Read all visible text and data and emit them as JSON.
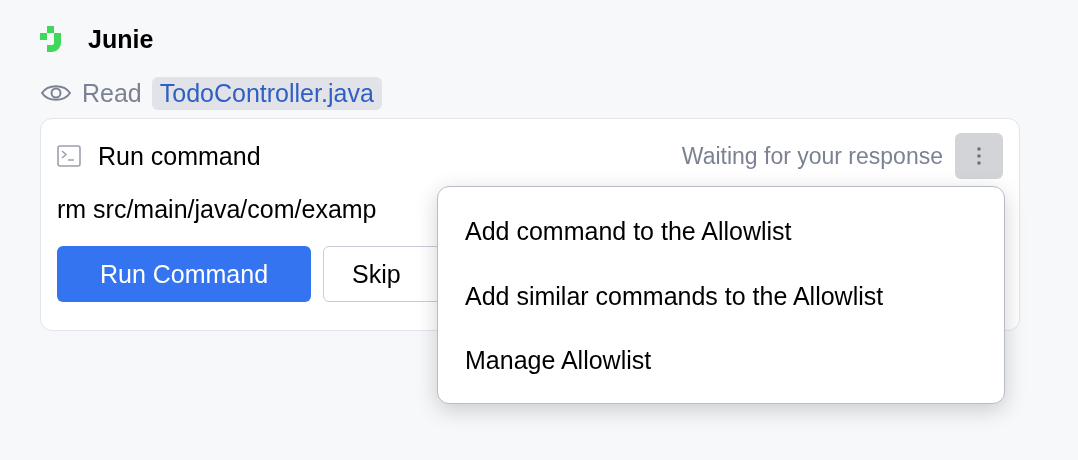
{
  "header": {
    "title": "Junie"
  },
  "activity": {
    "verb": "Read",
    "file": "TodoController.java"
  },
  "command_card": {
    "title": "Run command",
    "status": "Waiting for your response",
    "more_expanded": true,
    "command": "rm src/main/java/com/examp",
    "buttons": [
      {
        "label": "Run Command",
        "kind": "primary"
      },
      {
        "label": "Skip",
        "kind": "secondary"
      }
    ]
  },
  "menu": {
    "items": [
      "Add command to the Allowlist",
      "Add similar commands to the Allowlist",
      "Manage Allowlist"
    ]
  }
}
